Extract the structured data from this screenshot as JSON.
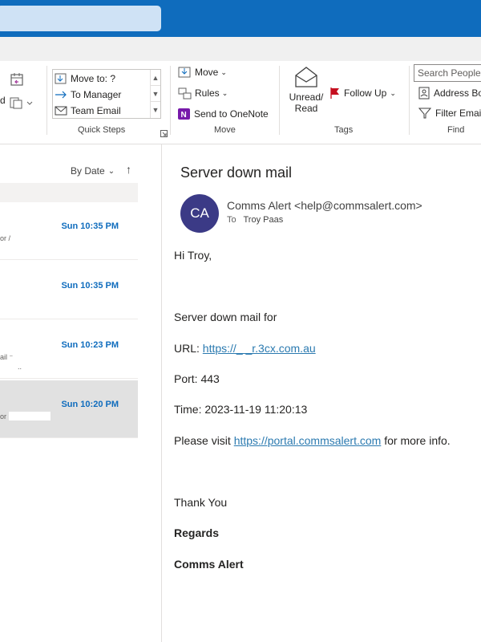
{
  "quick_steps": {
    "items": [
      "Move to: ?",
      "To Manager",
      "Team Email"
    ],
    "group_label": "Quick Steps"
  },
  "move_group": {
    "move_label": "Move",
    "rules_label": "Rules",
    "onenote_label": "Send to OneNote",
    "group_label": "Move"
  },
  "tags_group": {
    "unread_read_line1": "Unread/",
    "unread_read_line2": "Read",
    "follow_up_label": "Follow Up",
    "group_label": "Tags"
  },
  "find_group": {
    "search_people_placeholder": "Search People",
    "address_book_label": "Address Bo",
    "filter_email_label": "Filter Email",
    "group_label": "Find"
  },
  "ribbon_fragments": {
    "left_d": "d"
  },
  "message_list": {
    "sort_label": "By Date",
    "items": [
      {
        "date": "Sun 10:35 PM",
        "fragment": "or /",
        "selected": false
      },
      {
        "date": "Sun 10:35 PM",
        "fragment": "",
        "selected": false
      },
      {
        "date": "Sun 10:23 PM",
        "fragment": "ail ⁻",
        "fragment2": "..",
        "selected": false
      },
      {
        "date": "Sun 10:20 PM",
        "fragment": "or",
        "selected": true
      }
    ]
  },
  "reading_pane": {
    "subject": "Server down mail",
    "avatar_initials": "CA",
    "sender": "Comms Alert <help@commsalert.com>",
    "to_label": "To",
    "to_name": "Troy Paas",
    "greeting": "Hi Troy,",
    "line_server": "Server down mail for",
    "url_label": "URL: ",
    "url_link": "https://_ _r.3cx.com.au",
    "port": "Port: 443",
    "time": "Time: 2023-11-19 11:20:13",
    "visit_prefix": "Please visit ",
    "visit_link": "https://portal.commsalert.com",
    "visit_suffix": " for more info.",
    "thank_you": "Thank You",
    "regards": "Regards",
    "signature": "Comms Alert"
  },
  "colors": {
    "titlebar": "#0f6cbd",
    "accent_date": "#0f6cbd",
    "avatar": "#3b3a86",
    "link": "#2b7ab0",
    "selected_row": "#e1e1e1"
  }
}
